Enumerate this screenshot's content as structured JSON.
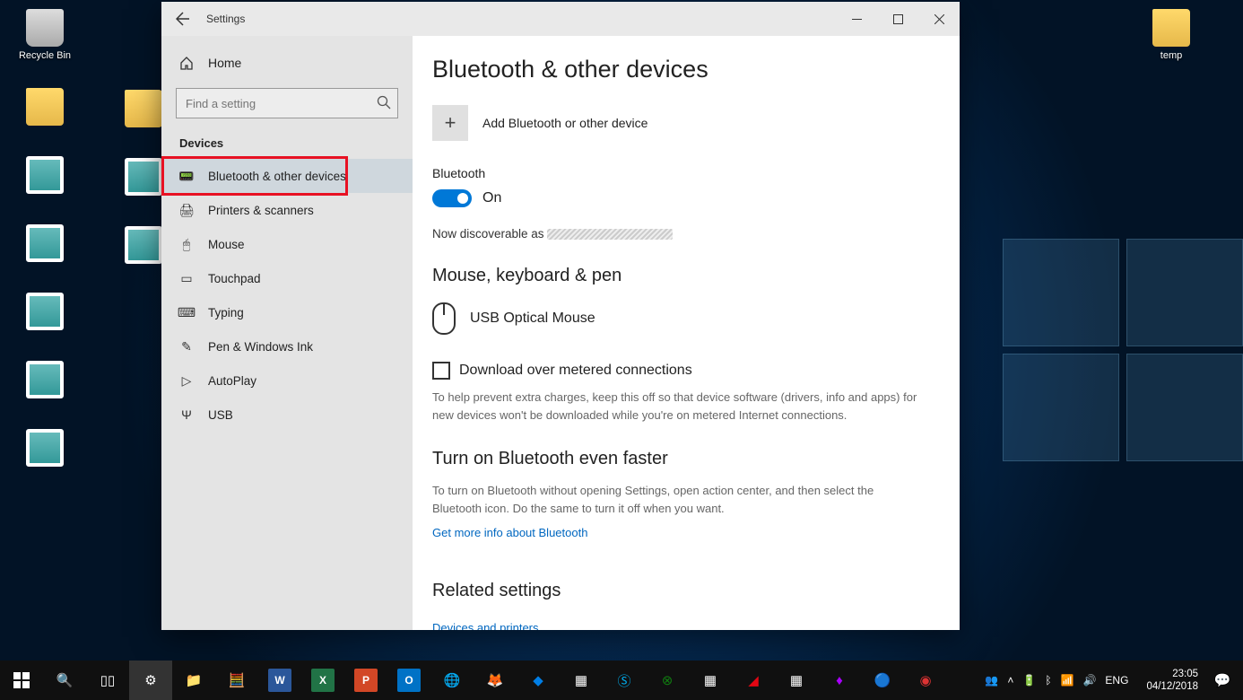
{
  "desktop": {
    "icons_left": [
      "Recycle Bin",
      "",
      "",
      "",
      "",
      "",
      ""
    ],
    "icons_col2": [
      "",
      "",
      "",
      ""
    ],
    "icon_right": "temp"
  },
  "window": {
    "back_aria": "Back",
    "title": "Settings",
    "sidebar": {
      "home": "Home",
      "search_placeholder": "Find a setting",
      "section": "Devices",
      "items": [
        {
          "label": "Bluetooth & other devices"
        },
        {
          "label": "Printers & scanners"
        },
        {
          "label": "Mouse"
        },
        {
          "label": "Touchpad"
        },
        {
          "label": "Typing"
        },
        {
          "label": "Pen & Windows Ink"
        },
        {
          "label": "AutoPlay"
        },
        {
          "label": "USB"
        }
      ]
    },
    "content": {
      "h1": "Bluetooth & other devices",
      "add_device": "Add Bluetooth or other device",
      "bt_label": "Bluetooth",
      "bt_state": "On",
      "discoverable_prefix": "Now discoverable as ",
      "section_mouse": "Mouse, keyboard & pen",
      "device1": "USB Optical Mouse",
      "metered_check": "Download over metered connections",
      "metered_help": "To help prevent extra charges, keep this off so that device software (drivers, info and apps) for new devices won't be downloaded while you're on metered Internet connections.",
      "faster_h": "Turn on Bluetooth even faster",
      "faster_help": "To turn on Bluetooth without opening Settings, open action center, and then select the Bluetooth icon. Do the same to turn it off when you want.",
      "faster_link": "Get more info about Bluetooth",
      "related_h": "Related settings",
      "related_link": "Devices and printers"
    }
  },
  "taskbar": {
    "lang": "ENG",
    "time": "23:05",
    "date": "04/12/2018"
  },
  "colors": {
    "accent": "#0078d7",
    "highlight": "#e81123"
  }
}
